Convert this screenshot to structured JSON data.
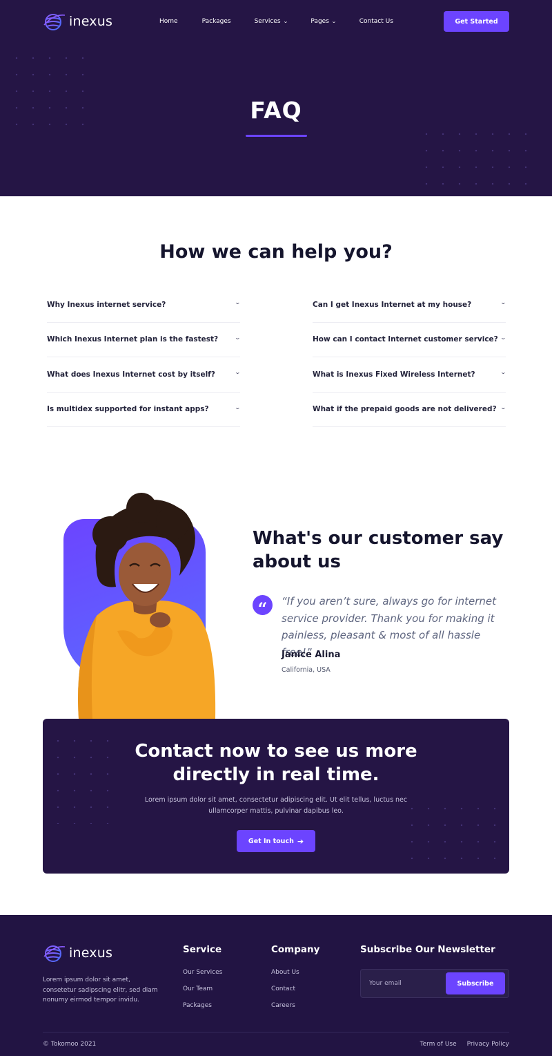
{
  "brand": {
    "name": "inexus",
    "accent_color": "#6c44ff",
    "dark_color": "#251545"
  },
  "nav": {
    "items": [
      {
        "label": "Home",
        "has_dropdown": false
      },
      {
        "label": "Packages",
        "has_dropdown": false
      },
      {
        "label": "Services",
        "has_dropdown": true
      },
      {
        "label": "Pages",
        "has_dropdown": true
      },
      {
        "label": "Contact Us",
        "has_dropdown": false
      }
    ],
    "cta_label": "Get Started"
  },
  "hero": {
    "title": "FAQ"
  },
  "faq": {
    "title": "How we can help you?",
    "left": [
      "Why Inexus internet service?",
      "Which Inexus Internet plan is the fastest?",
      "What does Inexus Internet cost by itself?",
      "Is multidex supported for instant apps?"
    ],
    "right": [
      "Can I get Inexus Internet at my house?",
      "How can I contact Internet customer service?",
      "What is Inexus Fixed Wireless Internet?",
      "What if the prepaid goods are not delivered?"
    ],
    "chevron_icon": "chevron-down-icon"
  },
  "testimonial": {
    "heading_line1": "What's our customer say",
    "heading_line2": "about us",
    "quote_icon": "quote-icon",
    "quote": "“If you aren’t sure, always go for internet service provider. Thank you for making it painless, pleasant & most of all hassle free!”",
    "name": "Janice Alina",
    "location": "California, USA"
  },
  "cta": {
    "title_line1": "Contact now to see us more",
    "title_line2": "directly in real time.",
    "text": "Lorem ipsum dolor sit amet, consectetur adipiscing elit. Ut elit tellus, luctus nec ullamcorper mattis, pulvinar dapibus leo.",
    "button_label": "Get In touch",
    "button_icon": "arrow-right-icon"
  },
  "footer": {
    "description": "Lorem ipsum dolor sit amet, consetetur sadipscing elitr, sed diam nonumy eirmod tempor invidu.",
    "service": {
      "title": "Service",
      "links": [
        "Our Services",
        "Our Team",
        "Packages"
      ]
    },
    "company": {
      "title": "Company",
      "links": [
        "About Us",
        "Contact",
        "Careers"
      ]
    },
    "newsletter": {
      "title": "Subscribe Our Newsletter",
      "placeholder": "Your email",
      "button_label": "Subscribe"
    },
    "copyright": "© Tokomoo 2021",
    "bottom_links": [
      "Term of Use",
      "Privacy Policy"
    ]
  }
}
